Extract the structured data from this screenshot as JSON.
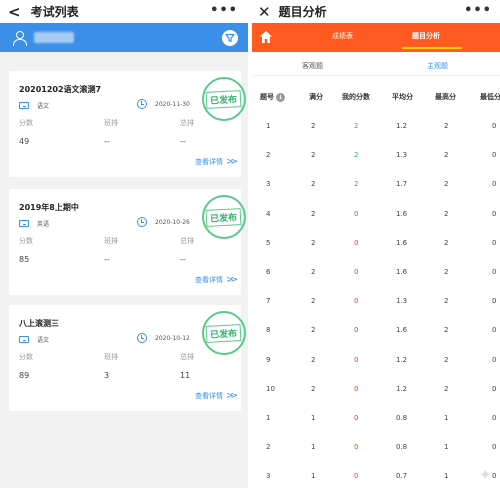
{
  "left": {
    "title": "考试列表",
    "back_glyph": "<",
    "more_glyph": "•••",
    "exams": [
      {
        "name": "20201202语文滚测7",
        "subject": "语文",
        "date": "2020-11-30",
        "status": "已发布",
        "score_label": "分数",
        "class_rank_label": "班排",
        "total_rank_label": "总排",
        "score": "49",
        "class_rank": "--",
        "total_rank": "--",
        "detail_label": "查看详情"
      },
      {
        "name": "2019年8上期中",
        "subject": "英语",
        "date": "2020-10-26",
        "status": "已发布",
        "score_label": "分数",
        "class_rank_label": "班排",
        "total_rank_label": "总排",
        "score": "85",
        "class_rank": "--",
        "total_rank": "--",
        "detail_label": "查看详情"
      },
      {
        "name": "八上滚测三",
        "subject": "语文",
        "date": "2020-10-12",
        "status": "已发布",
        "score_label": "分数",
        "class_rank_label": "班排",
        "total_rank_label": "总排",
        "score": "89",
        "class_rank": "3",
        "total_rank": "11",
        "detail_label": "查看详情"
      }
    ]
  },
  "right": {
    "title": "题目分析",
    "close_glyph": "✕",
    "more_glyph": "•••",
    "tabs": [
      "成绩表",
      "题目分析"
    ],
    "sub_tabs": [
      "客观题",
      "主观题"
    ],
    "columns": [
      "题号",
      "满分",
      "我的分数",
      "平均分",
      "最高分",
      "最低分"
    ],
    "sort_glyph": "↓",
    "rows": [
      [
        "1",
        "2",
        "2",
        "1.2",
        "2",
        "0"
      ],
      [
        "2",
        "2",
        "2",
        "1.3",
        "2",
        "0"
      ],
      [
        "3",
        "2",
        "2",
        "1.7",
        "2",
        "0"
      ],
      [
        "4",
        "2",
        "0",
        "1.6",
        "2",
        "0"
      ],
      [
        "5",
        "2",
        "0",
        "1.6",
        "2",
        "0"
      ],
      [
        "6",
        "2",
        "0",
        "1.6",
        "2",
        "0"
      ],
      [
        "7",
        "2",
        "0",
        "1.3",
        "2",
        "0"
      ],
      [
        "8",
        "2",
        "0",
        "1.6",
        "2",
        "0"
      ],
      [
        "9",
        "2",
        "0",
        "1.2",
        "2",
        "0"
      ],
      [
        "10",
        "2",
        "0",
        "1.2",
        "2",
        "0"
      ],
      [
        "1",
        "1",
        "0",
        "0.8",
        "1",
        "0"
      ],
      [
        "2",
        "1",
        "0",
        "0.8",
        "1",
        "0"
      ],
      [
        "3",
        "1",
        "0",
        "0.7",
        "1",
        "0"
      ]
    ],
    "my_score_colors": {
      "full": "#2fb36a",
      "zero": "#e8402a"
    }
  }
}
